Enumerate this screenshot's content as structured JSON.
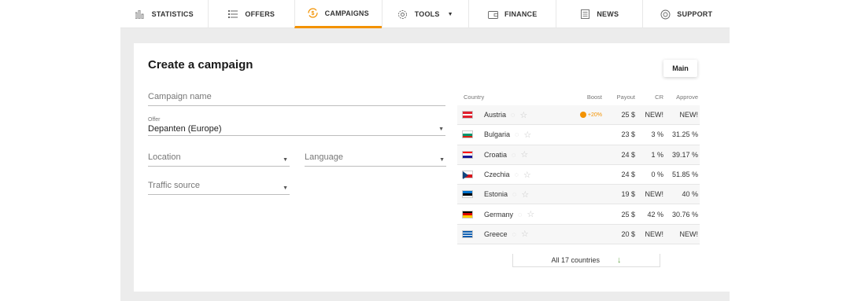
{
  "nav": {
    "items": [
      {
        "label": "STATISTICS",
        "icon": "bar-chart-icon"
      },
      {
        "label": "OFFERS",
        "icon": "list-icon"
      },
      {
        "label": "CAMPAIGNS",
        "icon": "campaign-icon"
      },
      {
        "label": "TOOLS",
        "icon": "gear-icon"
      },
      {
        "label": "FINANCE",
        "icon": "wallet-icon"
      },
      {
        "label": "NEWS",
        "icon": "news-icon"
      },
      {
        "label": "SUPPORT",
        "icon": "support-icon"
      }
    ],
    "active": "CAMPAIGNS",
    "accent": "#f39200"
  },
  "page": {
    "title": "Create a campaign",
    "main_button": "Main"
  },
  "form": {
    "campaign_name_placeholder": "Campaign name",
    "offer_label": "Offer",
    "offer_value": "Depanten (Europe)",
    "location_placeholder": "Location",
    "language_placeholder": "Language",
    "traffic_source_placeholder": "Traffic source"
  },
  "table": {
    "headers": {
      "country": "Country",
      "boost": "Boost",
      "payout": "Payout",
      "cr": "CR",
      "approve": "Approve"
    },
    "rows": [
      {
        "country": "Austria",
        "boost": "+20%",
        "payout": "25 $",
        "cr": "NEW!",
        "approve": "NEW!"
      },
      {
        "country": "Bulgaria",
        "boost": "",
        "payout": "23 $",
        "cr": "3 %",
        "approve": "31.25 %"
      },
      {
        "country": "Croatia",
        "boost": "",
        "payout": "24 $",
        "cr": "1 %",
        "approve": "39.17 %"
      },
      {
        "country": "Czechia",
        "boost": "",
        "payout": "24 $",
        "cr": "0 %",
        "approve": "51.85 %"
      },
      {
        "country": "Estonia",
        "boost": "",
        "payout": "19 $",
        "cr": "NEW!",
        "approve": "40 %"
      },
      {
        "country": "Germany",
        "boost": "",
        "payout": "25 $",
        "cr": "42 %",
        "approve": "30.76 %"
      },
      {
        "country": "Greece",
        "boost": "",
        "payout": "20 $",
        "cr": "NEW!",
        "approve": "NEW!"
      }
    ],
    "more_label": "All 17 countries"
  }
}
